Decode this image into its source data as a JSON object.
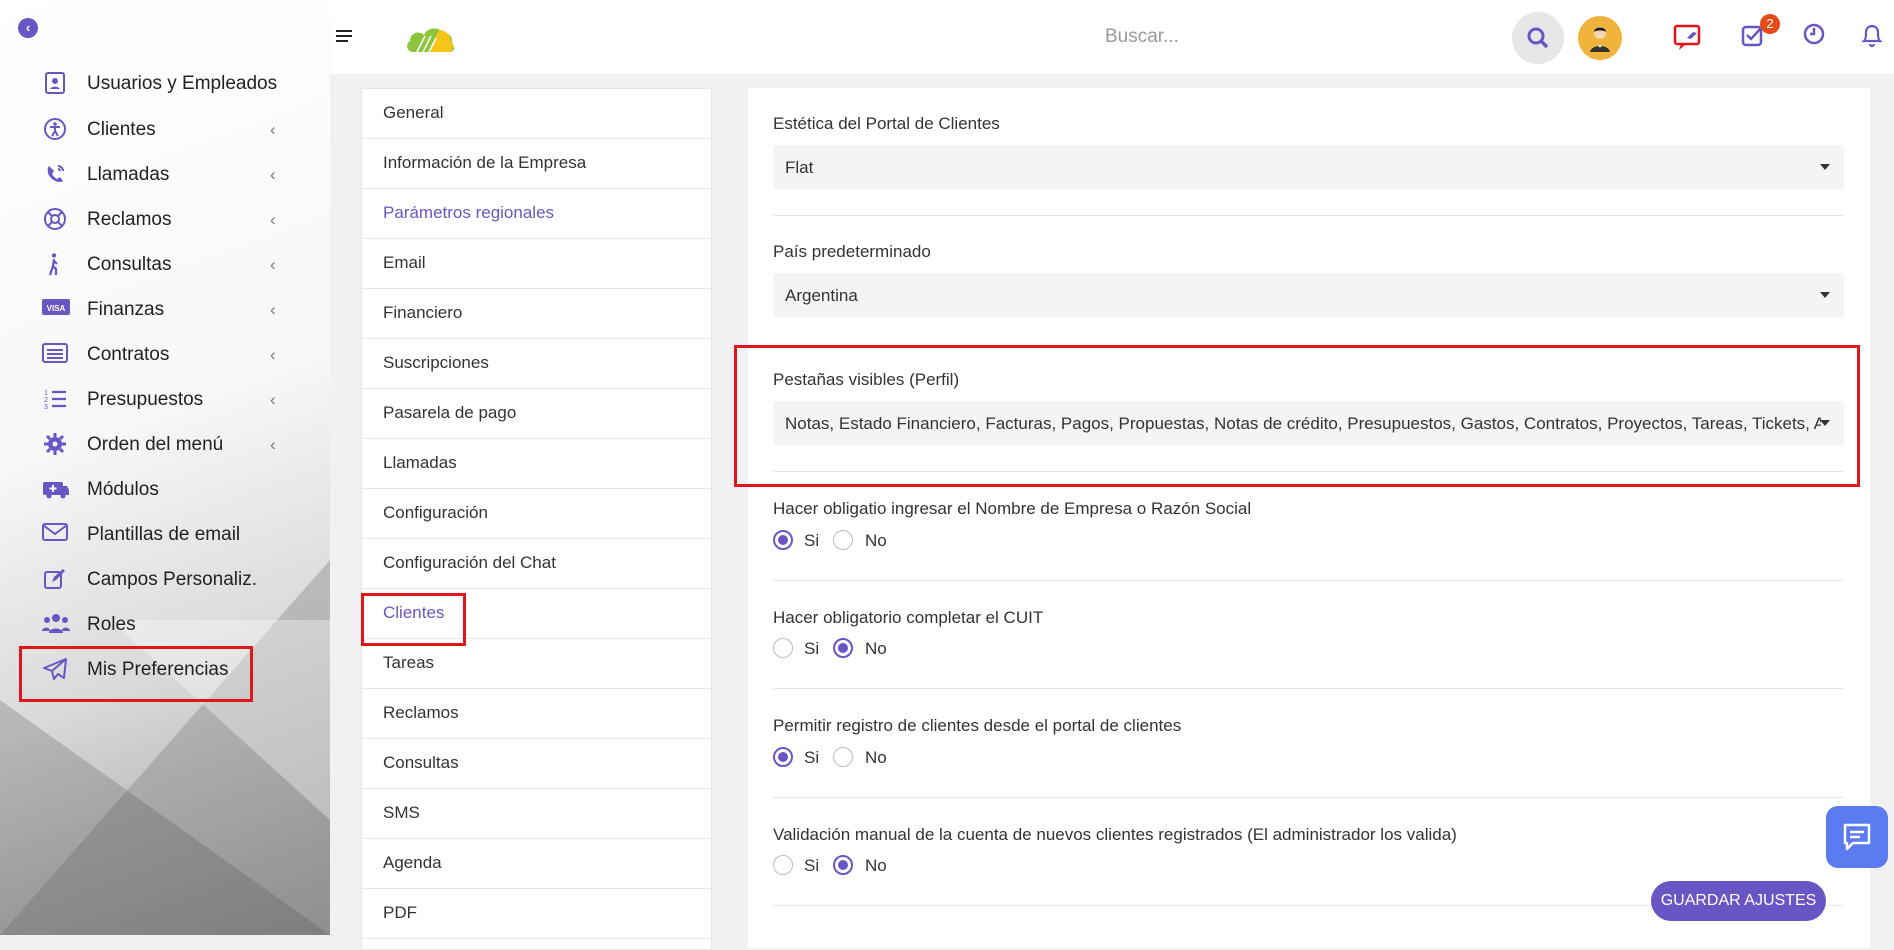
{
  "sidebar": {
    "items": [
      {
        "label": "Usuarios y Empleados",
        "icon": "user-badge-icon",
        "chevron": ""
      },
      {
        "label": "Clientes",
        "icon": "accessibility-icon",
        "chevron": "‹"
      },
      {
        "label": "Llamadas",
        "icon": "phone-ring-icon",
        "chevron": "‹"
      },
      {
        "label": "Reclamos",
        "icon": "lifebuoy-icon",
        "chevron": "‹"
      },
      {
        "label": "Consultas",
        "icon": "walking-person-icon",
        "chevron": "‹"
      },
      {
        "label": "Finanzas",
        "icon": "visa-card-icon",
        "chevron": "‹"
      },
      {
        "label": "Contratos",
        "icon": "list-card-icon",
        "chevron": "‹"
      },
      {
        "label": "Presupuestos",
        "icon": "numbered-list-icon",
        "chevron": "‹"
      },
      {
        "label": "Orden del menú",
        "icon": "gear-icon",
        "chevron": "‹"
      },
      {
        "label": "Módulos",
        "icon": "medkit-icon",
        "chevron": ""
      },
      {
        "label": "Plantillas de email",
        "icon": "envelope-icon",
        "chevron": ""
      },
      {
        "label": "Campos Personaliz.",
        "icon": "edit-icon",
        "chevron": ""
      },
      {
        "label": "Roles",
        "icon": "users-icon",
        "chevron": ""
      },
      {
        "label": "Mis Preferencias",
        "icon": "paper-plane-icon",
        "chevron": ""
      }
    ]
  },
  "header": {
    "search_placeholder": "Buscar...",
    "tasks_badge": "2",
    "accent_color": "#6a55c5"
  },
  "settings_menu": {
    "items": [
      "General",
      "Información de la Empresa",
      "Parámetros regionales",
      "Email",
      "Financiero",
      "Suscripciones",
      "Pasarela de pago",
      "Llamadas",
      "Configuración",
      "Configuración del Chat",
      "Clientes",
      "Tareas",
      "Reclamos",
      "Consultas",
      "SMS",
      "Agenda",
      "PDF"
    ],
    "active": "Clientes"
  },
  "panel": {
    "portal_style": {
      "label": "Estética del Portal de Clientes",
      "value": "Flat"
    },
    "default_country": {
      "label": "País predeterminado",
      "value": "Argentina"
    },
    "visible_tabs": {
      "label": "Pestañas visibles (Perfil)",
      "value": "Notas, Estado Financiero, Facturas, Pagos, Propuestas, Notas de crédito, Presupuestos, Gastos, Contratos, Proyectos, Tareas, Tickets, Archivos"
    },
    "radios": [
      {
        "label": "Hacer obligatio ingresar el Nombre de Empresa o Razón Social",
        "yes": "Si",
        "no": "No",
        "selected": "yes"
      },
      {
        "label": "Hacer obligatorio completar el CUIT",
        "yes": "Si",
        "no": "No",
        "selected": "no"
      },
      {
        "label": "Permitir registro de clientes desde el portal de clientes",
        "yes": "Si",
        "no": "No",
        "selected": "yes"
      },
      {
        "label": "Validación manual de la cuenta de nuevos clientes registrados (El administrador los valida)",
        "yes": "Si",
        "no": "No",
        "selected": "no"
      }
    ]
  },
  "save_button": "GUARDAR AJUSTES"
}
